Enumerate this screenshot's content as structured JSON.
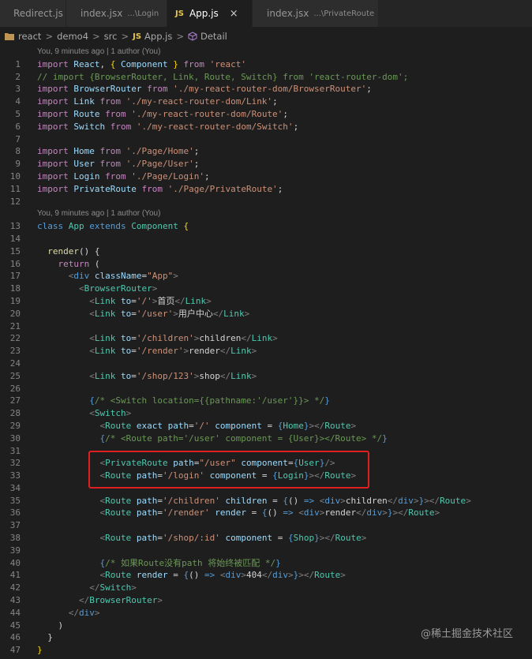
{
  "tabs": [
    {
      "icon": "redirect-js-icon",
      "name": "Redirect.js",
      "desc": ""
    },
    {
      "icon": "react-icon",
      "name": "index.jsx",
      "desc": "...\\Login"
    },
    {
      "icon": "js-icon",
      "name": "App.js",
      "desc": "",
      "active": true,
      "close": "×"
    },
    {
      "icon": "react-icon",
      "name": "index.jsx",
      "desc": "...\\PrivateRoute"
    }
  ],
  "breadcrumb": {
    "items": [
      "react",
      "demo4",
      "src",
      "App.js",
      "Detail"
    ],
    "separator": ">"
  },
  "editor": {
    "blame_annotations": [
      "You, 9 minutes ago | 1 author (You)",
      "You, 9 minutes ago | 1 author (You)"
    ],
    "line_numbers": [
      "1",
      "2",
      "3",
      "4",
      "5",
      "6",
      "7",
      "8",
      "9",
      "10",
      "11",
      "12",
      "13",
      "14",
      "15",
      "16",
      "17",
      "18",
      "19",
      "20",
      "21",
      "22",
      "23",
      "24",
      "25",
      "26",
      "27",
      "28",
      "29",
      "30",
      "31",
      "32",
      "33",
      "34",
      "35",
      "36",
      "37",
      "38",
      "39",
      "40",
      "41",
      "42",
      "43",
      "44",
      "45",
      "46",
      "47"
    ],
    "lines": [
      "import React, { Component } from 'react'",
      "// import {BrowserRouter, Link, Route, Switch} from 'react-router-dom';",
      "import BrowserRouter from './my-react-router-dom/BrowserRouter';",
      "import Link from './my-react-router-dom/Link';",
      "import Route from './my-react-router-dom/Route';",
      "import Switch from './my-react-router-dom/Switch';",
      "",
      "import Home from './Page/Home';",
      "import User from './Page/User';",
      "import Login from './Page/Login';",
      "import PrivateRoute from './Page/PrivateRoute';",
      "",
      "class App extends Component {",
      "",
      "  render() {",
      "    return (",
      "      <div className=\"App\">",
      "        <BrowserRouter>",
      "          <Link to='/'>首页</Link>",
      "          <Link to='/user'>用户中心</Link>",
      "",
      "          <Link to='/children'>children</Link>",
      "          <Link to='/render'>render</Link>",
      "",
      "          <Link to='/shop/123'>shop</Link>",
      "",
      "          {/* <Switch location={{pathname:'/user'}}> */}",
      "          <Switch>",
      "            <Route exact path='/' component = {Home}></Route>",
      "            {/* <Route path='/user' component = {User}></Route> */}",
      "",
      "            <PrivateRoute path=\"/user\" component={User}/>",
      "            <Route path='/login' component = {Login}></Route>",
      "",
      "            <Route path='/children' children = {() => <div>children</div>}></Route>",
      "            <Route path='/render' render = {() => <div>render</div>}></Route>",
      "",
      "            <Route path='/shop/:id' component = {Shop}></Route>",
      "",
      "            {/* 如果Route没有path 将始终被匹配 */}",
      "            <Route render = {() => <div>404</div>}></Route>",
      "          </Switch>",
      "        </BrowserRouter>",
      "      </div>",
      "    )",
      "  }",
      "}"
    ]
  },
  "watermark": "@稀土掘金技术社区",
  "colors": {
    "background": "#1e1e1e",
    "keyword": "#569cd6",
    "control": "#c586c0",
    "class": "#4ec9b0",
    "string": "#ce9178",
    "comment": "#6a9955",
    "variable": "#9cdcfe",
    "function": "#dcdcaa",
    "highlight_box": "#e02020"
  }
}
